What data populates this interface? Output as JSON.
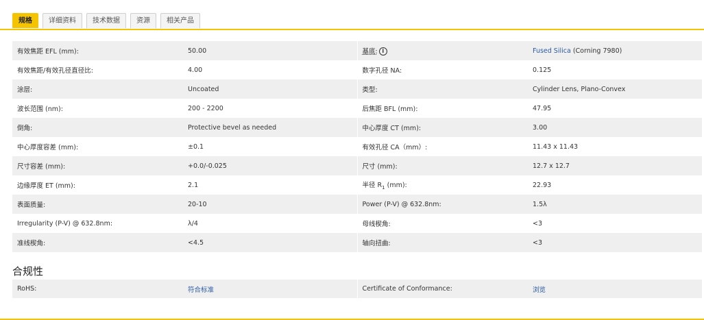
{
  "tabs": [
    {
      "label": "规格"
    },
    {
      "label": "详细资料"
    },
    {
      "label": "技术数据"
    },
    {
      "label": "资源"
    },
    {
      "label": "相关产品"
    }
  ],
  "specs": [
    {
      "l_label": "有效焦距 EFL (mm):",
      "l_value": "50.00",
      "r_label": "基底:",
      "r_value_link": "Fused Silica",
      "r_value_rest": " (Corning 7980)"
    },
    {
      "l_label": "有效焦距/有效孔径直径比:",
      "l_value": "4.00",
      "r_label": "数字孔径 NA:",
      "r_value": "0.125"
    },
    {
      "l_label": "涂层:",
      "l_value": "Uncoated",
      "r_label": "类型:",
      "r_value": "Cylinder Lens, Plano-Convex"
    },
    {
      "l_label": "波长范围 (nm):",
      "l_value": "200 - 2200",
      "r_label": "后焦距 BFL (mm):",
      "r_value": "47.95"
    },
    {
      "l_label": "倒角:",
      "l_value": "Protective bevel as needed",
      "r_label": "中心厚度 CT (mm):",
      "r_value": "3.00"
    },
    {
      "l_label": "中心厚度容差 (mm):",
      "l_value": "±0.1",
      "r_label": "有效孔径 CA（mm）:",
      "r_value": "11.43 x 11.43"
    },
    {
      "l_label": "尺寸容差 (mm):",
      "l_value": "+0.0/-0.025",
      "r_label": "尺寸 (mm):",
      "r_value": "12.7 x 12.7"
    },
    {
      "l_label": "边缘厚度 ET (mm):",
      "l_value": "2.1",
      "r_label_main": "半径 R",
      "r_label_sub": "1",
      "r_label_tail": " (mm):",
      "r_value": "22.93"
    },
    {
      "l_label": "表面质量:",
      "l_value": "20-10",
      "r_label": "Power (P-V) @ 632.8nm:",
      "r_value": "1.5λ"
    },
    {
      "l_label": "Irregularity (P-V) @ 632.8nm:",
      "l_value": "λ/4",
      "r_label": "母线楔角:",
      "r_value": "<3"
    },
    {
      "l_label": "准线楔角:",
      "l_value": "<4.5",
      "r_label": "轴向扭曲:",
      "r_value": "<3"
    }
  ],
  "substrate_info_icon": "i",
  "compliance": {
    "title": "合规性",
    "rohs_label": "RoHS:",
    "rohs_value": "符合标准",
    "coc_label": "Certificate of Conformance:",
    "coc_value": "浏览"
  },
  "colors": {
    "accent": "#f5c400",
    "link": "#2a5aa0",
    "row_alt": "#efefef"
  }
}
